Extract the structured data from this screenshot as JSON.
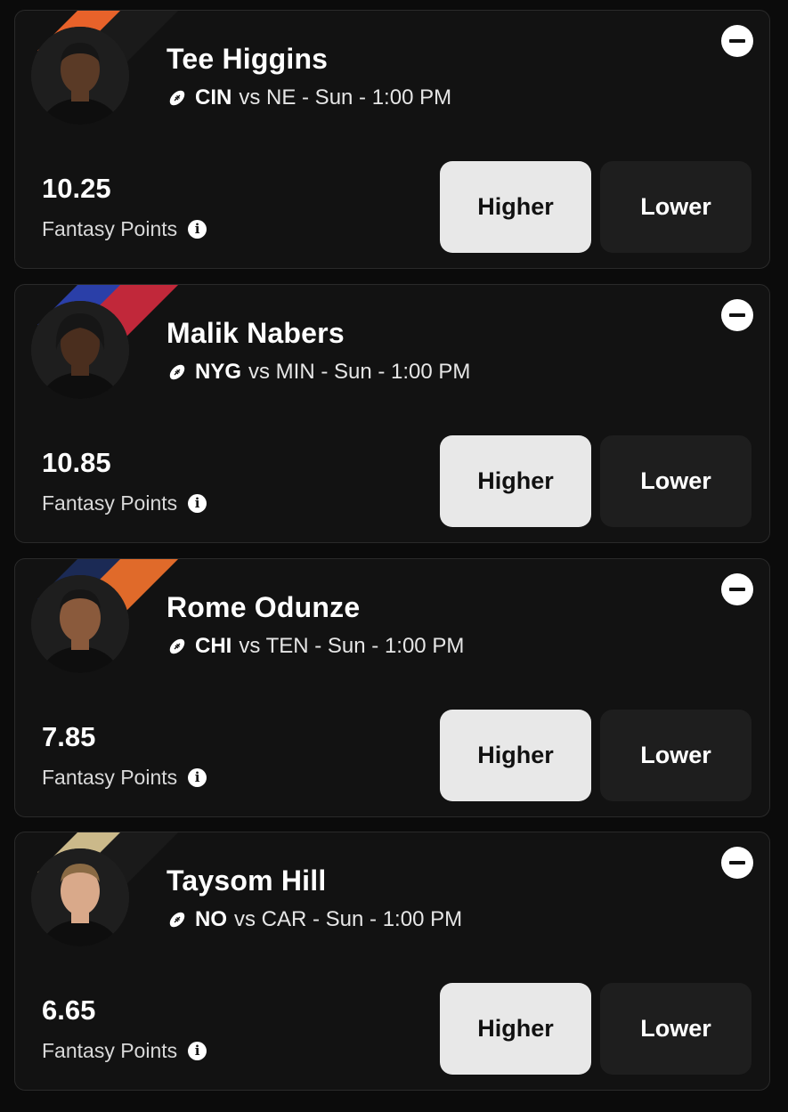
{
  "cards": [
    {
      "name": "Tee Higgins",
      "team": "CIN",
      "matchup_rest": "vs NE - Sun - 1:00 PM",
      "points": "10.25",
      "points_label": "Fantasy Points",
      "higher_label": "Higher",
      "lower_label": "Lower",
      "colors": {
        "primary": "#e8622a",
        "secondary": "#1a1a1a",
        "skin": "#5a3a26"
      }
    },
    {
      "name": "Malik Nabers",
      "team": "NYG",
      "matchup_rest": "vs MIN - Sun - 1:00 PM",
      "points": "10.85",
      "points_label": "Fantasy Points",
      "higher_label": "Higher",
      "lower_label": "Lower",
      "colors": {
        "primary": "#2a3fa8",
        "secondary": "#c1283a",
        "skin": "#4a2e1e"
      }
    },
    {
      "name": "Rome Odunze",
      "team": "CHI",
      "matchup_rest": "vs TEN - Sun - 1:00 PM",
      "points": "7.85",
      "points_label": "Fantasy Points",
      "higher_label": "Higher",
      "lower_label": "Lower",
      "colors": {
        "primary": "#1b2a55",
        "secondary": "#e06a2a",
        "skin": "#8a5a3c"
      }
    },
    {
      "name": "Taysom Hill",
      "team": "NO",
      "matchup_rest": "vs CAR - Sun - 1:00 PM",
      "points": "6.65",
      "points_label": "Fantasy Points",
      "higher_label": "Higher",
      "lower_label": "Lower",
      "colors": {
        "primary": "#cbb98a",
        "secondary": "#1a1a1a",
        "skin": "#d9a98a"
      }
    }
  ],
  "icons": {
    "sport": "football-icon",
    "remove": "minus-circle-icon",
    "info": "info-icon"
  }
}
